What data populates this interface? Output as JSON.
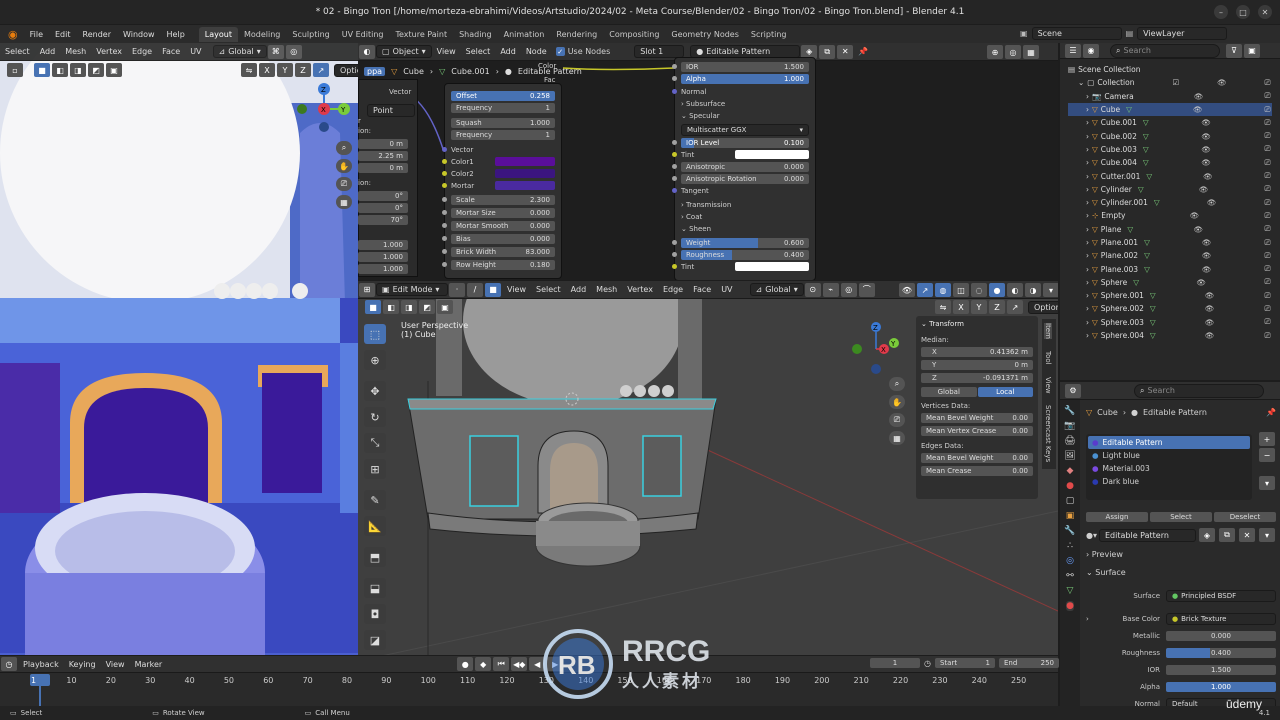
{
  "window": {
    "title": "* 02 - Bingo Tron [/home/morteza-ebrahimi/Videos/Artstudio/2024/02 - Meta Course/Blender/02 - Bingo Tron/02 - Bingo Tron.blend] - Blender 4.1"
  },
  "menu": {
    "items": [
      "File",
      "Edit",
      "Render",
      "Window",
      "Help"
    ],
    "workspaces": [
      "Layout",
      "Modeling",
      "Sculpting",
      "UV Editing",
      "Texture Paint",
      "Shading",
      "Animation",
      "Rendering",
      "Compositing",
      "Geometry Nodes",
      "Scripting"
    ],
    "scene": "Scene",
    "view_layer": "ViewLayer"
  },
  "left_view": {
    "menus": [
      "Select",
      "Add",
      "Mesh",
      "Vertex",
      "Edge",
      "Face",
      "UV"
    ],
    "orientation": "Global",
    "axes": [
      "X",
      "Y",
      "Z"
    ],
    "options": "Options",
    "fields": [
      {
        "label": "",
        "value": "0 m"
      },
      {
        "label": "",
        "value": "2.25 m"
      },
      {
        "label": "",
        "value": "0 m"
      },
      {
        "label": "",
        "value": "0°"
      },
      {
        "label": "",
        "value": "0°"
      },
      {
        "label": "",
        "value": "70°"
      },
      {
        "label": "",
        "value": "1.000"
      },
      {
        "label": "",
        "value": "1.000"
      },
      {
        "label": "",
        "value": "1.000"
      }
    ],
    "frag_pos": "ion:",
    "frag_rot": "ion:",
    "frag_r": "r",
    "frag_point": "Point"
  },
  "node_editor": {
    "header": {
      "object": "Object",
      "menus": [
        "View",
        "Select",
        "Add",
        "Node"
      ],
      "use_nodes": "Use Nodes",
      "slot": "Slot 1",
      "material": "Editable Pattern"
    },
    "breadcrumb": {
      "obj": "Cube",
      "mesh": "Cube.001",
      "mat": "Editable Pattern"
    },
    "vector_node": {
      "label": "Vector"
    },
    "brick": {
      "rows": [
        {
          "label": "Offset",
          "value": "0.258",
          "blue": true
        },
        {
          "label": "Frequency",
          "value": "1"
        },
        {
          "label": "Squash",
          "value": "1.000"
        },
        {
          "label": "Frequency",
          "value": "1"
        }
      ],
      "sockets": [
        "Vector",
        "Color1",
        "Color2",
        "Mortar"
      ],
      "params": [
        {
          "label": "Scale",
          "value": "2.300"
        },
        {
          "label": "Mortar Size",
          "value": "0.000"
        },
        {
          "label": "Mortar Smooth",
          "value": "0.000"
        },
        {
          "label": "Bias",
          "value": "0.000"
        },
        {
          "label": "Brick Width",
          "value": "83.000"
        },
        {
          "label": "Row Height",
          "value": "0.180"
        }
      ],
      "color1": "#5a0e9a",
      "color2": "#3b1580",
      "mortar": "#4a2aa0"
    },
    "color_out": "Color",
    "fac_out": "Fac",
    "bsdf": {
      "ior": {
        "label": "IOR",
        "value": "1.500"
      },
      "alpha": {
        "label": "Alpha",
        "value": "1.000"
      },
      "normal": "Normal",
      "subsurface": "Subsurface",
      "specular": "Specular",
      "multiscatter": "Multiscatter GGX",
      "spec_fields": [
        {
          "label": "IOR Level",
          "value": "0.100",
          "blue": true
        },
        {
          "label": "Anisotropic",
          "value": "0.000"
        },
        {
          "label": "Anisotropic Rotation",
          "value": "0.000"
        }
      ],
      "tint": "Tint",
      "tangent": "Tangent",
      "transmission": "Transmission",
      "coat": "Coat",
      "sheen": "Sheen",
      "sheen_fields": [
        {
          "label": "Weight",
          "value": "0.600",
          "fill": 0.6
        },
        {
          "label": "Roughness",
          "value": "0.400",
          "fill": 0.4
        }
      ],
      "tint2": "Tint"
    }
  },
  "viewport": {
    "mode": "Edit Mode",
    "menus": [
      "View",
      "Select",
      "Add",
      "Mesh",
      "Vertex",
      "Edge",
      "Face",
      "UV"
    ],
    "orientation": "Global",
    "axes": [
      "X",
      "Y",
      "Z"
    ],
    "options": "Options",
    "perspective": "User Perspective",
    "object": "(1) Cube",
    "side_tabs": [
      "Item",
      "Tool",
      "View",
      "Screencast Keys"
    ],
    "transform": {
      "title": "Transform",
      "median": "Median:",
      "x": {
        "label": "X",
        "value": "0.41362 m"
      },
      "y": {
        "label": "Y",
        "value": "0 m"
      },
      "z": {
        "label": "Z",
        "value": "-0.091371 m"
      },
      "global": "Global",
      "local": "Local",
      "vertices_data": "Vertices Data:",
      "mean_bevel_weight": "Mean Bevel Weight",
      "mean_vertex_crease": "Mean Vertex Crease",
      "v1": "0.00",
      "v2": "0.00",
      "edges_data": "Edges Data:",
      "edge_bevel": "Mean Bevel Weight",
      "mean_crease": "Mean Crease",
      "e1": "0.00",
      "e2": "0.00"
    }
  },
  "outliner": {
    "search": "Search",
    "scene_collection": "Scene Collection",
    "collection": "Collection",
    "items": [
      "Camera",
      "Cube",
      "Cube.001",
      "Cube.002",
      "Cube.003",
      "Cube.004",
      "Cutter.001",
      "Cylinder",
      "Cylinder.001",
      "Empty",
      "Plane",
      "Plane.001",
      "Plane.002",
      "Plane.003",
      "Sphere",
      "Sphere.001",
      "Sphere.002",
      "Sphere.003",
      "Sphere.004"
    ]
  },
  "properties": {
    "search": "Search",
    "breadcrumb_obj": "Cube",
    "breadcrumb_mat": "Editable Pattern",
    "slots": [
      {
        "name": "Editable Pattern",
        "color": "#5a3ccc"
      },
      {
        "name": "Light blue",
        "color": "#4a90d0"
      },
      {
        "name": "Material.003",
        "color": "#7a4ae0"
      },
      {
        "name": "Dark blue",
        "color": "#2a3ab0"
      }
    ],
    "assign": "Assign",
    "select": "Select",
    "deselect": "Deselect",
    "material_name": "Editable Pattern",
    "preview": "Preview",
    "surface_panel": "Surface",
    "surface": {
      "label": "Surface",
      "value": "Principled BSDF"
    },
    "base_color": {
      "label": "Base Color",
      "value": "Brick Texture"
    },
    "metallic": {
      "label": "Metallic",
      "value": "0.000"
    },
    "roughness": {
      "label": "Roughness",
      "value": "0.400"
    },
    "ior": {
      "label": "IOR",
      "value": "1.500"
    },
    "alpha": {
      "label": "Alpha",
      "value": "1.000"
    },
    "normal": {
      "label": "Normal",
      "value": "Default"
    }
  },
  "timeline": {
    "menus": [
      "Playback",
      "Keying",
      "View",
      "Marker"
    ],
    "current": "1",
    "start_label": "Start",
    "start": "1",
    "end_label": "End",
    "end": "250",
    "ticks": [
      "1",
      "10",
      "20",
      "30",
      "40",
      "50",
      "60",
      "70",
      "80",
      "90",
      "100",
      "110",
      "120",
      "130",
      "140",
      "150",
      "160",
      "170",
      "180",
      "190",
      "200",
      "210",
      "220",
      "230",
      "240",
      "250"
    ]
  },
  "status": {
    "select": "Select",
    "rotate": "Rotate View",
    "call_menu": "Call Menu",
    "version": "4.1"
  },
  "watermark": {
    "brand": "RRCG",
    "sub": "人人素材",
    "udemy": "ūdemy"
  }
}
